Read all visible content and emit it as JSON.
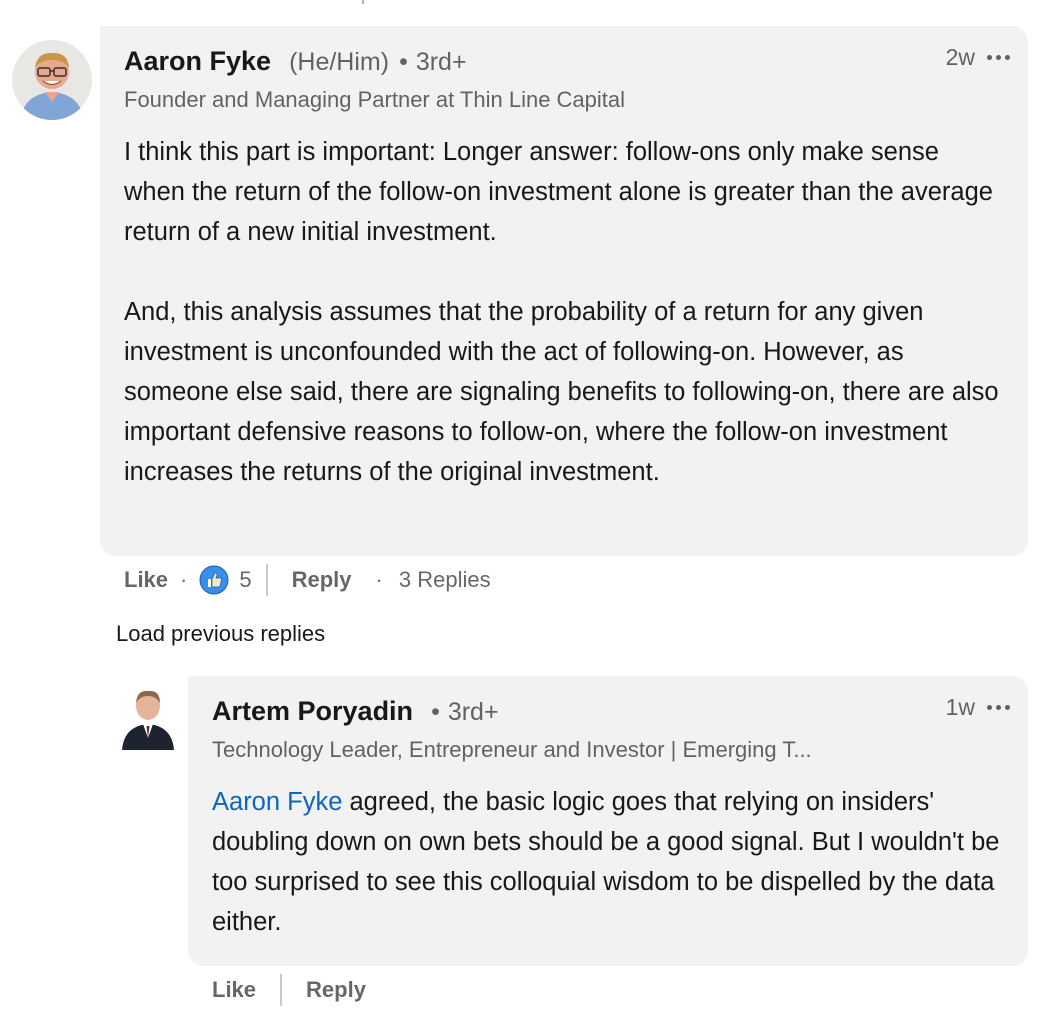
{
  "comments": [
    {
      "author": "Aaron Fyke",
      "pronouns": "(He/Him)",
      "degree": "3rd+",
      "headline": "Founder and Managing Partner at Thin Line Capital",
      "time": "2w",
      "text": "I think this part is important: Longer answer: follow-ons only make sense when the return of the follow-on investment alone is greater than the average return of a new initial investment.\n\nAnd, this analysis assumes that the probability of a return for any given investment is unconfounded with the act of following-on. However, as someone else said, there are signaling benefits to following-on, there are also important defensive reasons to follow-on, where the follow-on investment increases the returns of the original investment.",
      "actions": {
        "like_label": "Like",
        "reaction_count": "5",
        "reply_label": "Reply",
        "replies_label": "3 Replies"
      }
    }
  ],
  "load_previous_label": "Load previous replies",
  "reply": {
    "author": "Artem Poryadin",
    "degree": "3rd+",
    "headline": "Technology Leader, Entrepreneur and Investor | Emerging T...",
    "time": "1w",
    "mention": "Aaron Fyke",
    "text": " agreed, the basic logic goes that relying on insiders' doubling down on own bets should be a good signal. But I wouldn't be too surprised to see this colloquial wisdom to be dispelled by the data either.",
    "actions": {
      "like_label": "Like",
      "reply_label": "Reply"
    }
  },
  "colors": {
    "bubble": "#f2f2f2",
    "mention": "#0a66c2",
    "like_reaction": "#378fe9"
  },
  "icons": {
    "more": "more-horizontal-icon",
    "reaction": "like-reaction-icon"
  }
}
